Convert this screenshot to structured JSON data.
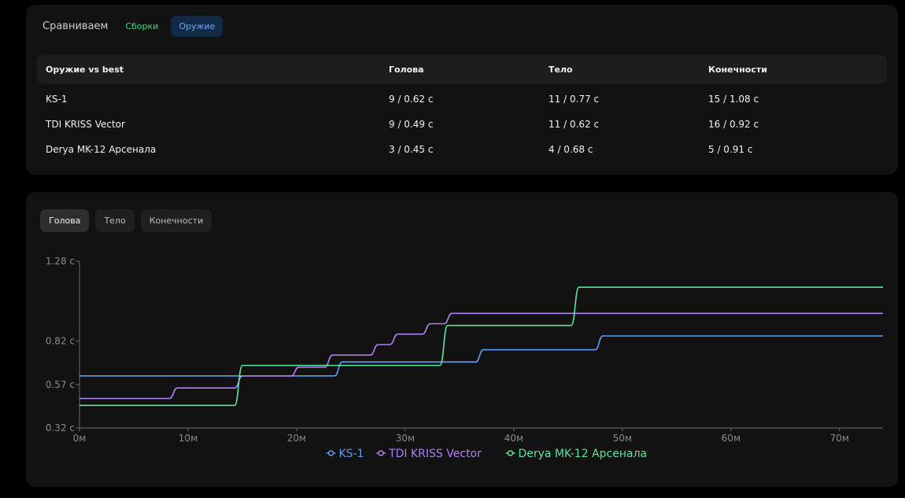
{
  "compare": {
    "label": "Сравниваем",
    "switch": [
      {
        "label": "Сборки",
        "color": "#3ddc84"
      },
      {
        "label": "Оружие",
        "color": "#6aa7ff",
        "active": true
      }
    ],
    "table": {
      "headers": [
        "Оружие vs best",
        "Голова",
        "Тело",
        "Конечности"
      ],
      "rows": [
        [
          "KS-1",
          "9 / 0.62 с",
          "11 / 0.77 с",
          "15 / 1.08 с"
        ],
        [
          "TDI KRISS Vector",
          "9 / 0.49 с",
          "11 / 0.62 с",
          "16 / 0.92 с"
        ],
        [
          "Derya MK-12 Арсенала",
          "3 / 0.45 с",
          "4 / 0.68 с",
          "5 / 0.91 с"
        ]
      ]
    }
  },
  "chart_tabs": [
    "Голова",
    "Тело",
    "Конечности"
  ],
  "chart_data": {
    "type": "line",
    "active_tab": "Голова",
    "xlabel": "",
    "ylabel": "",
    "xlim": [
      0,
      74
    ],
    "ylim": [
      0.32,
      1.28
    ],
    "x_ticks": [
      "0м",
      "10м",
      "20м",
      "30м",
      "40м",
      "50м",
      "60м",
      "70м"
    ],
    "y_ticks": [
      "0.32 с",
      "0.57 с",
      "0.82 с",
      "1.28 с"
    ],
    "y_tick_values": [
      0.32,
      0.57,
      0.82,
      1.28
    ],
    "legend_position": "bottom-center",
    "series": [
      {
        "name": "KS-1",
        "color": "#5b9cf5",
        "points": [
          [
            0,
            0.62
          ],
          [
            23.5,
            0.62
          ],
          [
            24.2,
            0.7
          ],
          [
            36.5,
            0.7
          ],
          [
            37.2,
            0.77
          ],
          [
            47.5,
            0.77
          ],
          [
            48.2,
            0.85
          ],
          [
            74,
            0.85
          ]
        ]
      },
      {
        "name": "TDI KRISS Vector",
        "color": "#b07ff2",
        "points": [
          [
            0,
            0.49
          ],
          [
            8.3,
            0.49
          ],
          [
            9,
            0.55
          ],
          [
            14.3,
            0.55
          ],
          [
            15,
            0.62
          ],
          [
            19.5,
            0.62
          ],
          [
            20.2,
            0.67
          ],
          [
            22.6,
            0.67
          ],
          [
            23.3,
            0.74
          ],
          [
            26.8,
            0.74
          ],
          [
            27.5,
            0.8
          ],
          [
            28.6,
            0.8
          ],
          [
            29.3,
            0.86
          ],
          [
            31.6,
            0.86
          ],
          [
            32.3,
            0.92
          ],
          [
            33.6,
            0.92
          ],
          [
            34.3,
            0.98
          ],
          [
            74,
            0.98
          ]
        ]
      },
      {
        "name": "Derya MK-12 Арсенала",
        "color": "#5ee39a",
        "points": [
          [
            0,
            0.45
          ],
          [
            14.3,
            0.45
          ],
          [
            15,
            0.68
          ],
          [
            33.2,
            0.68
          ],
          [
            33.9,
            0.91
          ],
          [
            45.3,
            0.91
          ],
          [
            46,
            1.13
          ],
          [
            74,
            1.13
          ]
        ]
      }
    ]
  }
}
